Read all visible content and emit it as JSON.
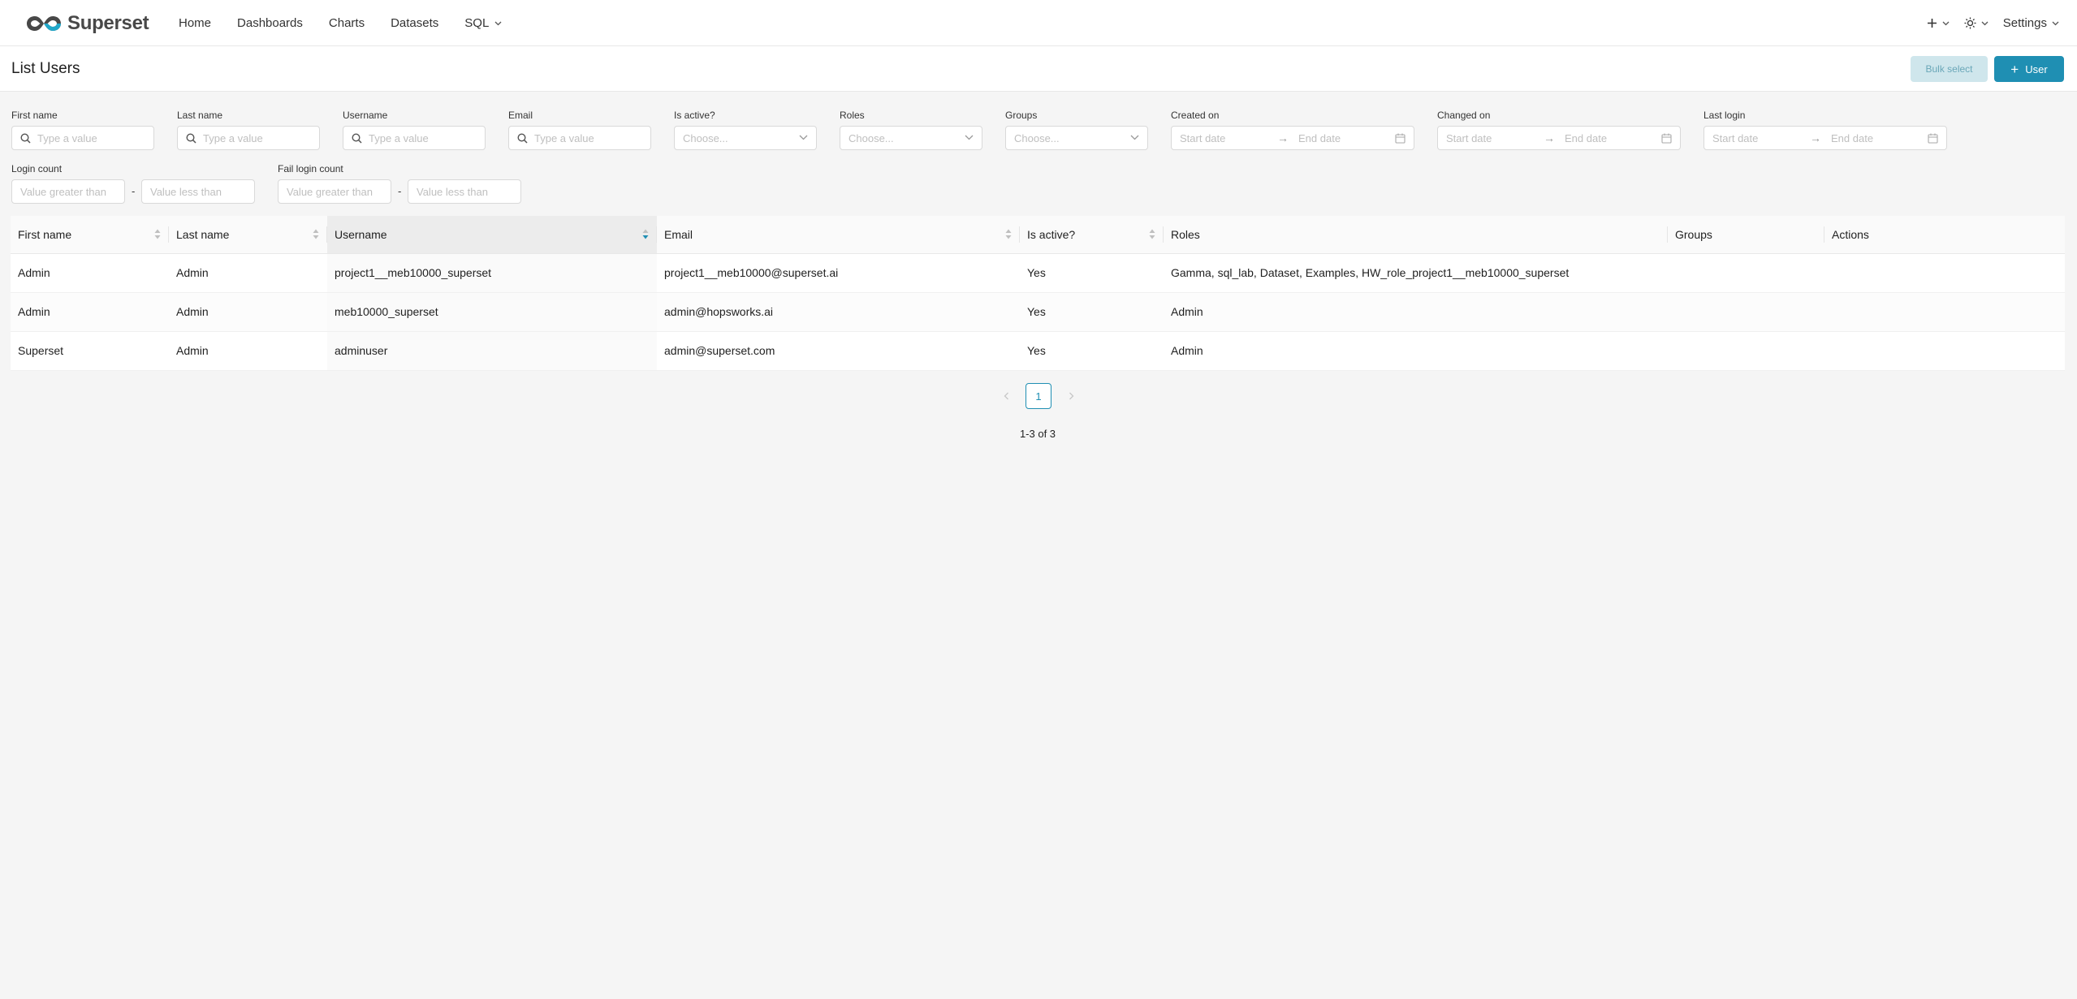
{
  "brand": {
    "name": "Superset",
    "accent": "#1f8fb3"
  },
  "nav": {
    "items": [
      {
        "label": "Home"
      },
      {
        "label": "Dashboards"
      },
      {
        "label": "Charts"
      },
      {
        "label": "Datasets"
      },
      {
        "label": "SQL"
      }
    ],
    "settings_label": "Settings"
  },
  "page": {
    "title": "List Users",
    "bulk_select_label": "Bulk select",
    "add_user_label": "User"
  },
  "filters": {
    "first_name": {
      "label": "First name",
      "placeholder": "Type a value"
    },
    "last_name": {
      "label": "Last name",
      "placeholder": "Type a value"
    },
    "username": {
      "label": "Username",
      "placeholder": "Type a value"
    },
    "email": {
      "label": "Email",
      "placeholder": "Type a value"
    },
    "is_active": {
      "label": "Is active?",
      "placeholder": "Choose..."
    },
    "roles": {
      "label": "Roles",
      "placeholder": "Choose..."
    },
    "groups": {
      "label": "Groups",
      "placeholder": "Choose..."
    },
    "created_on": {
      "label": "Created on",
      "start": "Start date",
      "end": "End date"
    },
    "changed_on": {
      "label": "Changed on",
      "start": "Start date",
      "end": "End date"
    },
    "last_login": {
      "label": "Last login",
      "start": "Start date",
      "end": "End date"
    },
    "login_count": {
      "label": "Login count",
      "min": "Value greater than",
      "max": "Value less than"
    },
    "fail_login_count": {
      "label": "Fail login count",
      "min": "Value greater than",
      "max": "Value less than"
    },
    "range_separator": "-"
  },
  "table": {
    "columns": [
      "First name",
      "Last name",
      "Username",
      "Email",
      "Is active?",
      "Roles",
      "Groups",
      "Actions"
    ],
    "rows": [
      [
        "Admin",
        "Admin",
        "project1__meb10000_superset",
        "project1__meb10000@superset.ai",
        "Yes",
        "Gamma, sql_lab, Dataset, Examples, HW_role_project1__meb10000_superset",
        "",
        ""
      ],
      [
        "Admin",
        "Admin",
        "meb10000_superset",
        "admin@hopsworks.ai",
        "Yes",
        "Admin",
        "",
        ""
      ],
      [
        "Superset",
        "Admin",
        "adminuser",
        "admin@superset.com",
        "Yes",
        "Admin",
        "",
        ""
      ]
    ]
  },
  "pagination": {
    "current_page": "1",
    "summary": "1-3 of 3"
  }
}
